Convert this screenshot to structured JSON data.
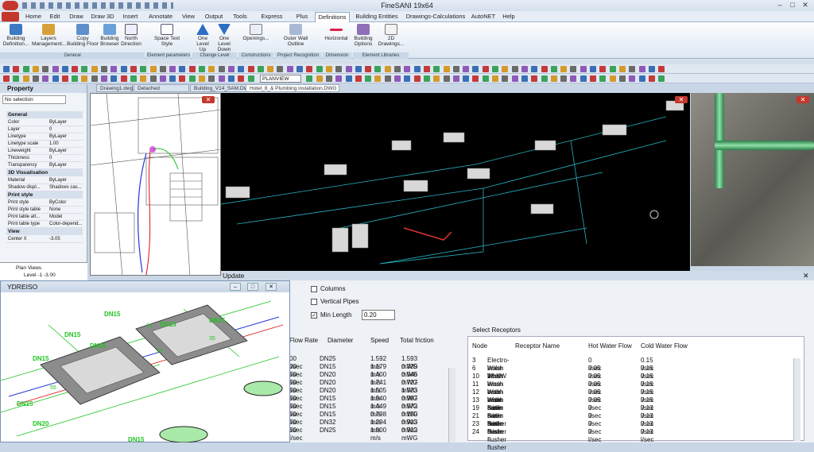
{
  "app": {
    "title": "FineSANI 19x64"
  },
  "tabs": [
    "Home",
    "Edit",
    "Draw",
    "Draw 3D",
    "Insert",
    "Annotate",
    "View",
    "Output",
    "Tools",
    "Express Tools",
    "Plus",
    "Definitions",
    "Building Entities",
    "Drawings-Calculations",
    "AutoNET",
    "Help"
  ],
  "ribbon": {
    "buttons": [
      {
        "label": "Building Definition..."
      },
      {
        "label": "Layers Management..."
      },
      {
        "label": "Copy Building Floor"
      },
      {
        "label": "Building Browser"
      },
      {
        "label": "North Direction"
      },
      {
        "label": "Space Text Style"
      },
      {
        "label": "One Level Up"
      },
      {
        "label": "One Level Down"
      },
      {
        "label": "Openings..."
      },
      {
        "label": "Outer Wall Outline"
      },
      {
        "label": "Horizontal"
      },
      {
        "label": "Building Options"
      },
      {
        "label": "2D Drawings..."
      }
    ],
    "groups": [
      "General",
      "Element parameters",
      "Change Level",
      "Constructions",
      "Project Recognition",
      "Dimension",
      "Element Libraries"
    ]
  },
  "toolbar": {
    "view_select": "PLANVIEW"
  },
  "property": {
    "title": "Property",
    "selection": "No selection",
    "general": {
      "title": "General",
      "rows": [
        [
          "Color",
          "ByLayer"
        ],
        [
          "Layer",
          "0"
        ],
        [
          "Linetype",
          "ByLayer"
        ],
        [
          "Linetype scale",
          "1.00"
        ],
        [
          "Lineweight",
          "ByLayer"
        ],
        [
          "Thickness",
          "0"
        ],
        [
          "Transparency",
          "ByLayer"
        ]
      ]
    },
    "visual": {
      "title": "3D Visualisation",
      "rows": [
        [
          "Material",
          "ByLayer"
        ],
        [
          "Shadow displ...",
          "Shadows cas..."
        ]
      ]
    },
    "print": {
      "title": "Print style",
      "rows": [
        [
          "Print style",
          "ByColor"
        ],
        [
          "Print style table",
          "None"
        ],
        [
          "Print table att...",
          "Model"
        ],
        [
          "Print table type",
          "Color-depend..."
        ]
      ]
    },
    "view": {
      "title": "View",
      "rows": [
        [
          "Center X",
          "-3.05"
        ]
      ]
    }
  },
  "tree": {
    "root": "Plan Views",
    "child": "Level -1  -3.00"
  },
  "doc_tabs": [
    "Drawing1.dwg",
    "Detached house.DWG",
    "Building_V14_SAM.DWG",
    "Hotel_8_& Plumbing installation.DWG"
  ],
  "update": {
    "title": "Update",
    "columns_label": "Columns",
    "vertical_pipes_label": "Vertical Pipes",
    "min_length_label": "Min Length",
    "min_length_value": "0.20",
    "flow_headers": [
      "Flow Rate",
      "Diameter",
      "Speed",
      "Total friction"
    ],
    "flow_rows": [
      [
        "00 l/sec",
        "DN25",
        "1.592 m/s",
        "1.593 mWG"
      ],
      [
        "00 l/sec",
        "DN15",
        "1.179 m/s",
        "0.329 mWG"
      ],
      [
        "50 l/sec",
        "DN20",
        "1.400 m/s",
        "0.546 mWG"
      ],
      [
        "50 l/sec",
        "DN20",
        "1.741 m/s",
        "0.727 mWG"
      ],
      [
        "50 l/sec",
        "DN20",
        "1.505 m/s",
        "1.523 mWG"
      ],
      [
        "50 l/sec",
        "DN15",
        "1.940 m/s",
        "0.997 mWG"
      ],
      [
        "50 l/sec",
        "DN15",
        "1.449 m/s",
        "0.572 mWG"
      ],
      [
        "50 l/sec",
        "DN15",
        "0.798 m/s",
        "0.150 mWG"
      ],
      [
        "50 l/sec",
        "DN32",
        "1.294 m/s",
        "0.913 mWG"
      ],
      [
        "50 l/sec",
        "DN25",
        "1.900 m/s",
        "0.912 mWG"
      ]
    ],
    "select_receptors_label": "Select Receptors",
    "rec_headers": [
      "Node",
      "Receptor Name",
      "Hot Water Flow",
      "Cold Water Flow"
    ],
    "rec_rows": [
      [
        "3",
        "Electro-boiler 18 KW",
        "0 l/sec",
        "0.15 l/sec"
      ],
      [
        "6",
        "Wash basin - bath mixer",
        "0.05 l/sec",
        "0.15 l/sec"
      ],
      [
        "10",
        "Wash basin - bath mixer",
        "0.05 l/sec",
        "0.15 l/sec"
      ],
      [
        "11",
        "Wash basin - bath mixer",
        "0.05 l/sec",
        "0.15 l/sec"
      ],
      [
        "12",
        "Wash basin - bath mixer",
        "0.05 l/sec",
        "0.15 l/sec"
      ],
      [
        "13",
        "Wash basin - bath mixer",
        "0.05 l/sec",
        "0.15 l/sec"
      ],
      [
        "19",
        "Basin - flusher",
        "0 l/sec",
        "0.13 l/sec"
      ],
      [
        "21",
        "Basin - flusher",
        "0 l/sec",
        "0.13 l/sec"
      ],
      [
        "23",
        "Basin - flusher",
        "0 l/sec",
        "0.13 l/sec"
      ],
      [
        "24",
        "Basin - flusher",
        "0 l/sec",
        "0.13 l/sec"
      ]
    ]
  },
  "ydreiso": {
    "title": "YDREISO",
    "labels": [
      "DN15",
      "DN15",
      "DN15",
      "DN15",
      "DN15",
      "DN15",
      "DN20",
      "DN15",
      "DN15"
    ],
    "numbers": [
      "31",
      "34",
      "35",
      "55"
    ]
  },
  "colors": {
    "accent": "#c4382c",
    "pipe_green": "#21c421",
    "pipe_blue": "#2436d8",
    "viewport_bg": "#000000"
  }
}
